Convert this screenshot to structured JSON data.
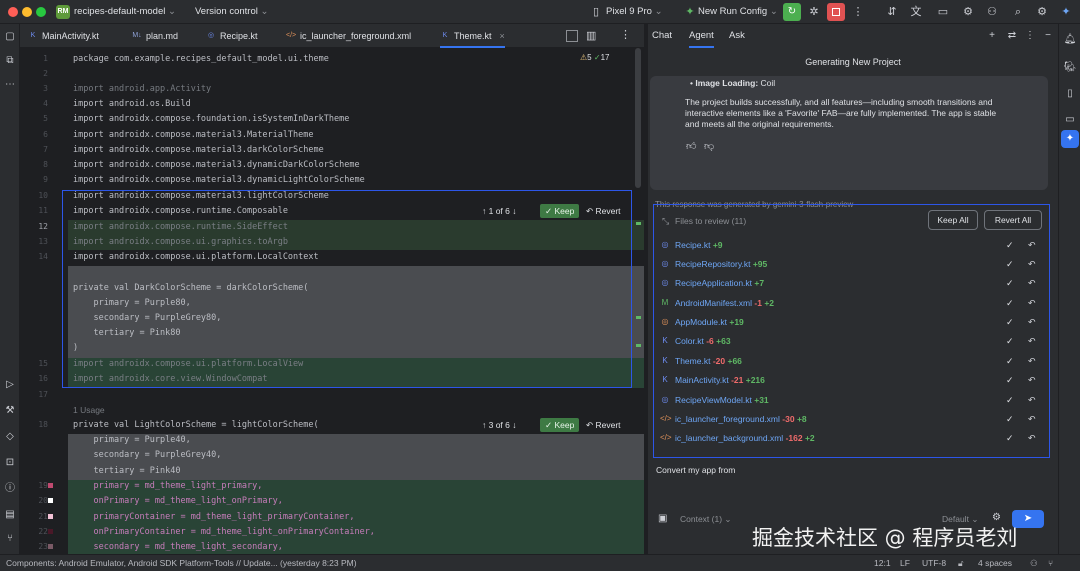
{
  "titlebar": {
    "project_badge": "RM",
    "project_name": "recipes-default-model",
    "vcs": "Version control",
    "device": "Pixel 9 Pro",
    "run_config": "New Run Config",
    "chevron": "⌄"
  },
  "tabs": [
    {
      "label": "MainActivity.kt",
      "icon": "K",
      "color": "#6e8cf0"
    },
    {
      "label": "plan.md",
      "icon": "M↓",
      "color": "#8fa2d8"
    },
    {
      "label": "Recipe.kt",
      "icon": "◎",
      "color": "#6e8cf0"
    },
    {
      "label": "ic_launcher_foreground.xml",
      "icon": "</>",
      "color": "#e0925a"
    },
    {
      "label": "Theme.kt",
      "icon": "K",
      "color": "#6e8cf0"
    }
  ],
  "editor": {
    "warnings": "5",
    "checks": "17",
    "lines": [
      {
        "n": "1",
        "text": "package com.example.recipes_default_model.ui.theme"
      },
      {
        "n": "3",
        "text": "import android.app.Activity"
      },
      {
        "n": "4",
        "text": "import android.os.Build"
      },
      {
        "n": "5",
        "text": "import androidx.compose.foundation.isSystemInDarkTheme"
      },
      {
        "n": "6",
        "text": "import androidx.compose.material3.MaterialTheme"
      },
      {
        "n": "7",
        "text": "import androidx.compose.material3.darkColorScheme"
      },
      {
        "n": "8",
        "text": "import androidx.compose.material3.dynamicDarkColorScheme"
      },
      {
        "n": "9",
        "text": "import androidx.compose.material3.dynamicLightColorScheme"
      },
      {
        "n": "10",
        "text": "import androidx.compose.material3.lightColorScheme"
      },
      {
        "n": "11",
        "text": "import androidx.compose.runtime.Composable"
      },
      {
        "n": "12",
        "text": "import androidx.compose.runtime.SideEffect"
      },
      {
        "n": "13",
        "text": "import androidx.compose.ui.graphics.toArgb"
      },
      {
        "n": "14",
        "text": "import androidx.compose.ui.platform.LocalContext"
      },
      {
        "n": "",
        "text": "private val DarkColorScheme = darkColorScheme("
      },
      {
        "n": "",
        "text": "    primary = Purple80,"
      },
      {
        "n": "",
        "text": "    secondary = PurpleGrey80,"
      },
      {
        "n": "",
        "text": "    tertiary = Pink80"
      },
      {
        "n": "",
        "text": ")"
      },
      {
        "n": "15",
        "text": "import androidx.compose.ui.platform.LocalView"
      },
      {
        "n": "16",
        "text": "import androidx.core.view.WindowCompat"
      },
      {
        "n": "17",
        "text": ""
      },
      {
        "n": "",
        "text": "1 Usage"
      },
      {
        "n": "18",
        "text": "private val LightColorScheme = lightColorScheme("
      },
      {
        "n": "",
        "text": "    primary = Purple40,"
      },
      {
        "n": "",
        "text": "    secondary = PurpleGrey40,"
      },
      {
        "n": "",
        "text": "    tertiary = Pink40"
      },
      {
        "n": "19",
        "text": "    primary = md_theme_light_primary,"
      },
      {
        "n": "20",
        "text": "    onPrimary = md_theme_light_onPrimary,"
      },
      {
        "n": "21",
        "text": "    primaryContainer = md_theme_light_primaryContainer,"
      },
      {
        "n": "22",
        "text": "    onPrimaryContainer = md_theme_light_onPrimaryContainer,"
      },
      {
        "n": "23",
        "text": "    secondary = md_theme_light_secondary,"
      }
    ],
    "diff_controls": [
      {
        "nav": "↑  1 of 6  ↓",
        "keep": "✓ Keep",
        "revert": "↶ Revert"
      },
      {
        "nav": "↑  3 of 6  ↓",
        "keep": "✓ Keep",
        "revert": "↶ Revert"
      }
    ]
  },
  "agent_panel": {
    "tabs": [
      "Chat",
      "Agent",
      "Ask"
    ],
    "title": "Generating New Project",
    "bullet_label": "Image Loading:",
    "bullet_value": "Coil",
    "message": "The project builds successfully, and all features—including smooth transitions and interactive elements like a 'Favorite' FAB—are fully implemented. The app is stable and meets all the original requirements.",
    "message_lines": [
      "The project builds successfully, and all features—including smooth transitions and",
      "interactive elements like a 'Favorite' FAB—are fully implemented. The app is stable",
      "and meets all the original requirements."
    ],
    "generated_note": "This response was generated by gemini-3-flash-preview",
    "review_title": "Files to review (11)",
    "keep_all": "Keep All",
    "revert_all": "Revert All",
    "files": [
      {
        "name": "Recipe.kt",
        "del": "",
        "add": "+9",
        "icon": "◎",
        "icolor": "#6e8cf0"
      },
      {
        "name": "RecipeRepository.kt",
        "del": "",
        "add": "+95",
        "icon": "◎",
        "icolor": "#6e8cf0"
      },
      {
        "name": "RecipeApplication.kt",
        "del": "",
        "add": "+7",
        "icon": "◎",
        "icolor": "#6e8cf0"
      },
      {
        "name": "AndroidManifest.xml",
        "del": "-1",
        "add": "+2",
        "icon": "M",
        "icolor": "#5fb865"
      },
      {
        "name": "AppModule.kt",
        "del": "",
        "add": "+19",
        "icon": "◎",
        "icolor": "#e0925a"
      },
      {
        "name": "Color.kt",
        "del": "-6",
        "add": "+63",
        "icon": "K",
        "icolor": "#6e8cf0"
      },
      {
        "name": "Theme.kt",
        "del": "-20",
        "add": "+66",
        "icon": "K",
        "icolor": "#6e8cf0"
      },
      {
        "name": "MainActivity.kt",
        "del": "-21",
        "add": "+216",
        "icon": "K",
        "icolor": "#6e8cf0"
      },
      {
        "name": "RecipeViewModel.kt",
        "del": "",
        "add": "+31",
        "icon": "◎",
        "icolor": "#6e8cf0"
      },
      {
        "name": "ic_launcher_foreground.xml",
        "del": "-30",
        "add": "+8",
        "icon": "</>",
        "icolor": "#e0925a"
      },
      {
        "name": "ic_launcher_background.xml",
        "del": "-162",
        "add": "+2",
        "icon": "</>",
        "icolor": "#e0925a"
      }
    ],
    "input_text": "Convert my app from",
    "context": "Context (1)",
    "model": "Default",
    "watermark": "掘金技术社区 @ 程序员老刘"
  },
  "status": {
    "left": "Components: Android Emulator, Android SDK Platform-Tools // Update...  (yesterday 8:23 PM)",
    "pos": "12:1",
    "lf": "LF",
    "enc": "UTF-8",
    "indent": "4 spaces"
  },
  "colors": {
    "accent": "#3574f0",
    "keep": "#3e7a44",
    "run_green": "#4caf50",
    "stop_red": "#e05252"
  }
}
